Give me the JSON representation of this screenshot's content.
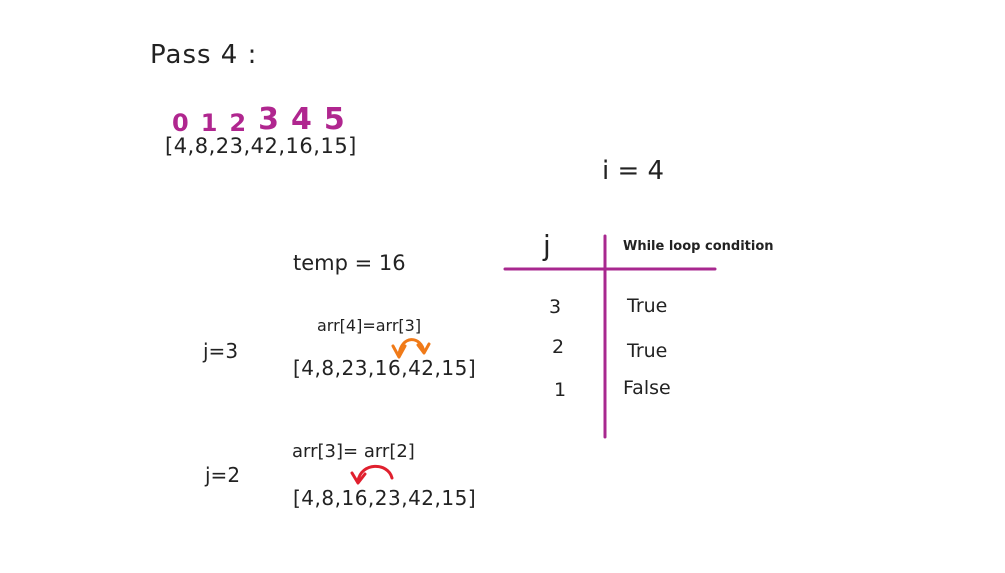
{
  "title": "Pass 4 :",
  "indices": [
    "0",
    "1",
    "2",
    "3",
    "4",
    "5"
  ],
  "initial_array": "[4,8,23,42,16,15]",
  "i_label": "i = 4",
  "temp_label": "temp = 16",
  "steps": [
    {
      "j_label": "j=3",
      "assignment": "arr[4]=arr[3]",
      "array": "[4,8,23,16,42,15]",
      "arrow_color": "#f07a18"
    },
    {
      "j_label": "j=2",
      "assignment": "arr[3]= arr[2]",
      "array": "[4,8,16,23,42,15]",
      "arrow_color": "#e0202e"
    }
  ],
  "table": {
    "col_j": "j",
    "col_condition": "While loop condition",
    "rows": [
      {
        "j": "3",
        "condition": "True"
      },
      {
        "j": "2",
        "condition": "True"
      },
      {
        "j": "1",
        "condition": "False"
      }
    ],
    "line_color": "#a8288f"
  }
}
